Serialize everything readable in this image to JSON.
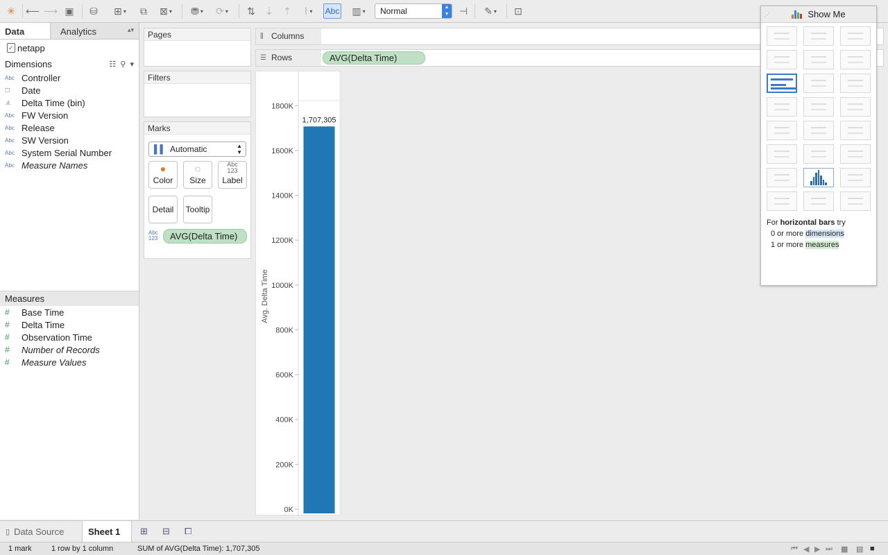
{
  "toolbar": {
    "fit_select": "Normal",
    "text_toggle": "Abc"
  },
  "data_pane": {
    "tabs": [
      "Data",
      "Analytics"
    ],
    "datasource": "netapp",
    "dimensions_title": "Dimensions",
    "dimensions": [
      {
        "type": "Abc",
        "name": "Controller",
        "italic": false
      },
      {
        "type": "date",
        "name": "Date",
        "italic": false
      },
      {
        "type": "bin",
        "name": "Delta Time (bin)",
        "italic": false
      },
      {
        "type": "Abc",
        "name": "FW Version",
        "italic": false
      },
      {
        "type": "Abc",
        "name": "Release",
        "italic": false
      },
      {
        "type": "Abc",
        "name": "SW Version",
        "italic": false
      },
      {
        "type": "Abc",
        "name": "System Serial Number",
        "italic": false
      },
      {
        "type": "Abc",
        "name": "Measure Names",
        "italic": true
      }
    ],
    "measures_title": "Measures",
    "measures": [
      {
        "name": "Base Time",
        "italic": false
      },
      {
        "name": "Delta Time",
        "italic": false
      },
      {
        "name": "Observation Time",
        "italic": false
      },
      {
        "name": "Number of Records",
        "italic": true
      },
      {
        "name": "Measure Values",
        "italic": true
      }
    ]
  },
  "cards": {
    "pages": "Pages",
    "filters": "Filters",
    "marks": "Marks",
    "mark_type": "Automatic",
    "buttons": {
      "color": "Color",
      "size": "Size",
      "label": "Label",
      "detail": "Detail",
      "tooltip": "Tooltip"
    },
    "label_icon_top": "Abc",
    "label_icon_bottom": "123",
    "marks_pill": "AVG(Delta Time)"
  },
  "shelves": {
    "columns_label": "Columns",
    "rows_label": "Rows",
    "rows_pill": "AVG(Delta Time)"
  },
  "chart_data": {
    "type": "bar",
    "categories": [
      ""
    ],
    "values": [
      1707305
    ],
    "data_labels": [
      "1,707,305"
    ],
    "ylabel": "Avg. Delta Time",
    "ylim": [
      0,
      1900000
    ],
    "yticks": [
      0,
      200000,
      400000,
      600000,
      800000,
      1000000,
      1200000,
      1400000,
      1600000,
      1800000
    ],
    "ytick_labels": [
      "0K",
      "200K",
      "400K",
      "600K",
      "800K",
      "1000K",
      "1200K",
      "1400K",
      "1600K",
      "1800K"
    ],
    "bar_color": "#1f77b4"
  },
  "show_me": {
    "title": "Show Me",
    "hint_prefix": "For",
    "hint_bold": "horizontal bars",
    "hint_suffix": "try",
    "hint_line2_pre": "0 or more",
    "hint_line2_hl": "dimensions",
    "hint_line3_pre": "1 or more",
    "hint_line3_hl": "measures"
  },
  "sheet_tabs": {
    "data_source": "Data Source",
    "sheet": "Sheet 1"
  },
  "status": {
    "marks": "1 mark",
    "rows_cols": "1 row by 1 column",
    "sum": "SUM of AVG(Delta Time): 1,707,305"
  }
}
